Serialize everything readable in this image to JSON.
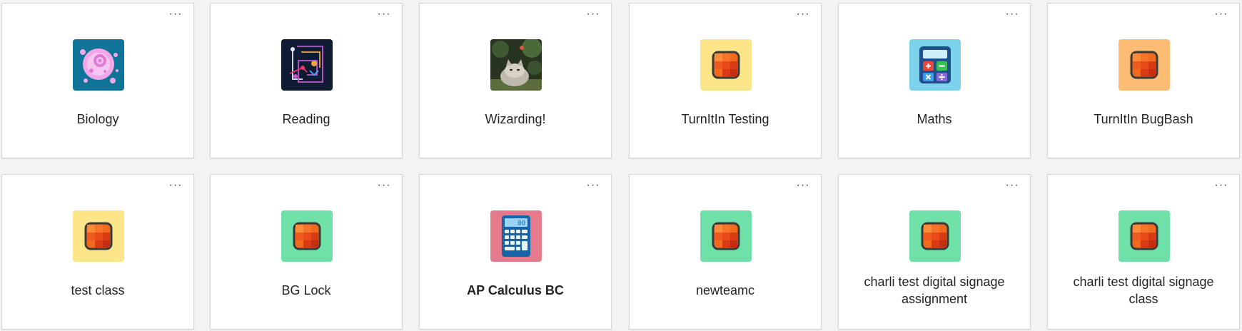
{
  "more_label": "···",
  "cards": [
    {
      "title": "Biology",
      "icon": "biology-cell-icon",
      "bg": "#0f7497"
    },
    {
      "title": "Reading",
      "icon": "circuit-path-icon",
      "bg": "#0e1b33"
    },
    {
      "title": "Wizarding!",
      "icon": "cat-photo-icon",
      "bg": "#2d3b2a"
    },
    {
      "title": "TurnItIn Testing",
      "icon": "grid-square-icon",
      "bg": "#fde68a"
    },
    {
      "title": "Maths",
      "icon": "calculator-icon",
      "bg": "#7dd3ec"
    },
    {
      "title": "TurnItIn BugBash",
      "icon": "grid-square-icon",
      "bg": "#fdbc74"
    },
    {
      "title": "test class",
      "icon": "grid-square-icon",
      "bg": "#fde68a"
    },
    {
      "title": "BG Lock",
      "icon": "grid-square-icon",
      "bg": "#6ee0a8"
    },
    {
      "title": "AP Calculus BC",
      "icon": "calculator-icon",
      "bg": "#e57a8c",
      "calc_display": "00"
    },
    {
      "title": "newteamc",
      "icon": "grid-square-icon",
      "bg": "#6ee0a8"
    },
    {
      "title": "charli test digital signage assignment",
      "icon": "grid-square-icon",
      "bg": "#6ee0a8"
    },
    {
      "title": "charli test digital signage class",
      "icon": "grid-square-icon",
      "bg": "#6ee0a8"
    }
  ]
}
